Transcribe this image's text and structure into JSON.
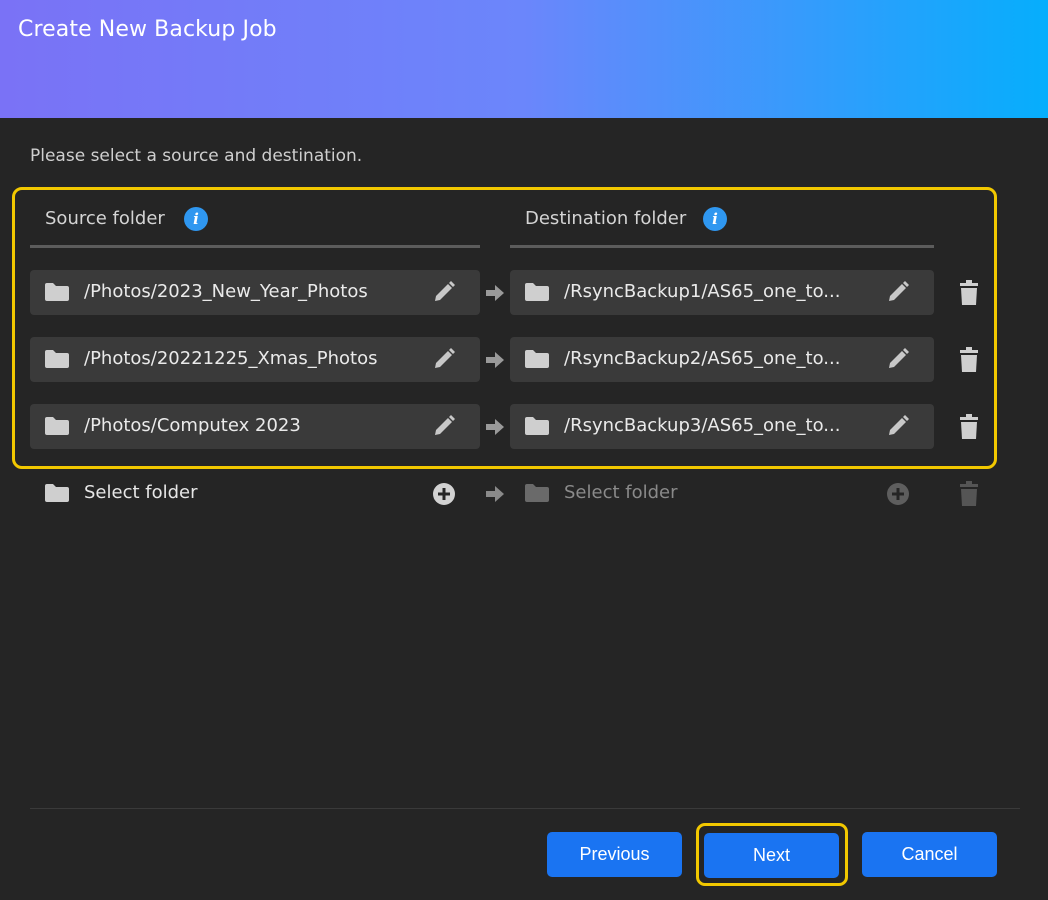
{
  "header": {
    "title": "Create New Backup Job"
  },
  "instructions": "Please select a source and destination.",
  "columns": {
    "source": "Source folder",
    "destination": "Destination folder",
    "info_glyph": "i"
  },
  "rows": [
    {
      "source": "/Photos/2023_New_Year_Photos",
      "destination": "/RsyncBackup1/AS65_one_to..."
    },
    {
      "source": "/Photos/20221225_Xmas_Photos",
      "destination": "/RsyncBackup2/AS65_one_to..."
    },
    {
      "source": "/Photos/Computex 2023",
      "destination": "/RsyncBackup3/AS65_one_to..."
    }
  ],
  "empty_row": {
    "source_placeholder": "Select folder",
    "destination_placeholder": "Select folder"
  },
  "buttons": {
    "previous": "Previous",
    "next": "Next",
    "cancel": "Cancel"
  },
  "colors": {
    "gradient_start": "#7a72f6",
    "gradient_end": "#06aefc",
    "accent_button": "#1a74f2",
    "highlight": "#f2c800",
    "info_icon": "#2f97f0"
  }
}
